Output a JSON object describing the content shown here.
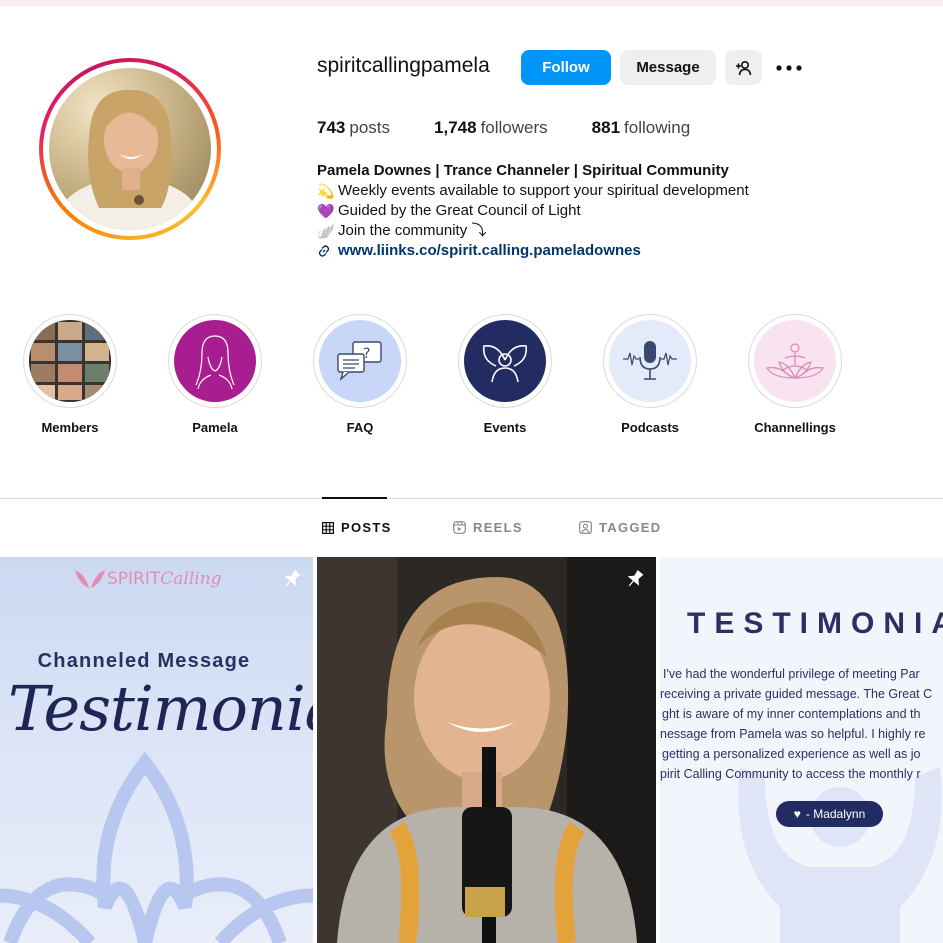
{
  "profile": {
    "username": "spiritcallingpamela",
    "follow_label": "Follow",
    "message_label": "Message",
    "stats": {
      "posts_count": "743",
      "posts_label": "posts",
      "followers_count": "1,748",
      "followers_label": "followers",
      "following_count": "881",
      "following_label": "following"
    },
    "bio": {
      "name": "Pamela Downes | Trance Channeler | Spiritual Community",
      "lines": [
        {
          "emoji": "💫",
          "text": "Weekly events available to support your spiritual development"
        },
        {
          "emoji": "💜",
          "text": "Guided by the Great Council of Light"
        },
        {
          "emoji": "🪽",
          "text": "Join the community ⤵"
        }
      ],
      "link": "www.liinks.co/spirit.calling.pameladownes"
    }
  },
  "highlights": [
    {
      "label": "Members"
    },
    {
      "label": "Pamela"
    },
    {
      "label": "FAQ"
    },
    {
      "label": "Events"
    },
    {
      "label": "Podcasts"
    },
    {
      "label": "Channellings"
    }
  ],
  "tabs": {
    "posts": "POSTS",
    "reels": "REELS",
    "tagged": "TAGGED"
  },
  "posts": {
    "post1": {
      "brand_prefix": "SPIRIT",
      "brand_suffix": "Calling",
      "subtitle": "Channeled Message",
      "title": "Testimonial"
    },
    "post3": {
      "title": "TESTIMONIA",
      "quote_lines": [
        "I've had the wonderful privilege of meeting Par",
        "receiving a private guided message. The Great C",
        "ght is aware of my inner contemplations and th",
        "nessage from Pamela was so helpful. I highly re",
        "getting a personalized experience as well as jo",
        "pirit Calling Community to access the monthly r"
      ],
      "author": "- Madalynn"
    }
  },
  "colors": {
    "follow_blue": "#0095f6",
    "link_blue": "#00376b",
    "navy": "#222c63",
    "magenta": "#a81d8f"
  }
}
